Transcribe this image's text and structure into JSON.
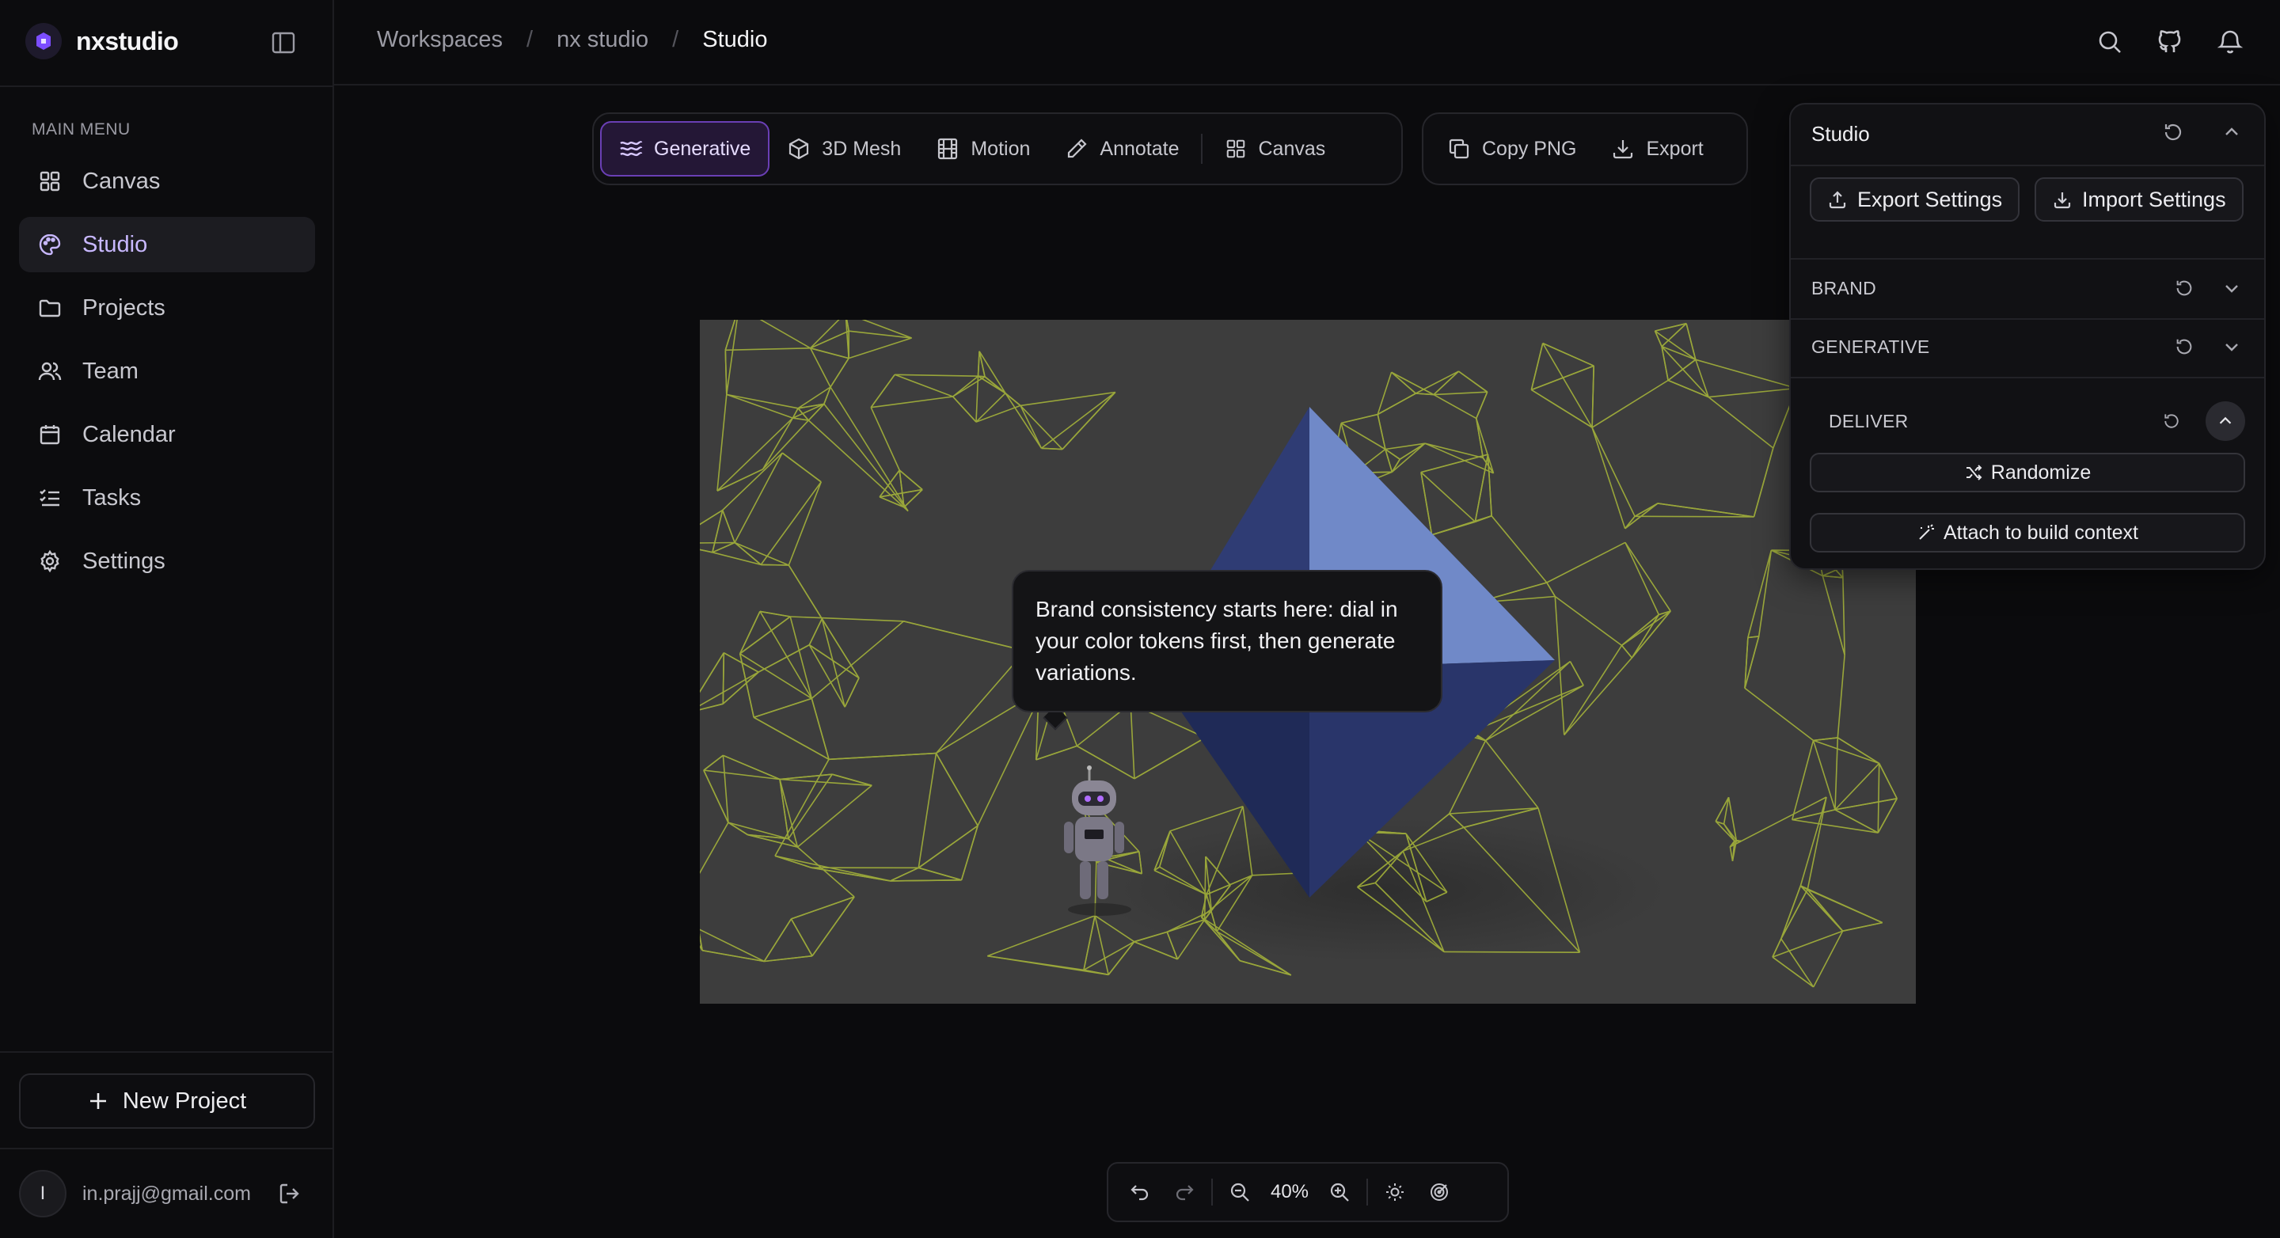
{
  "app": {
    "name": "nxstudio"
  },
  "sidebar": {
    "menu_heading": "MAIN MENU",
    "items": [
      {
        "label": "Canvas",
        "icon": "grid-icon",
        "active": false
      },
      {
        "label": "Studio",
        "icon": "palette-icon",
        "active": true
      },
      {
        "label": "Projects",
        "icon": "folder-icon",
        "active": false
      },
      {
        "label": "Team",
        "icon": "users-icon",
        "active": false
      },
      {
        "label": "Calendar",
        "icon": "calendar-icon",
        "active": false
      },
      {
        "label": "Tasks",
        "icon": "list-check-icon",
        "active": false
      },
      {
        "label": "Settings",
        "icon": "gear-icon",
        "active": false
      }
    ],
    "new_project_label": "New Project",
    "user": {
      "initial": "I",
      "email": "in.prajj@gmail.com"
    }
  },
  "breadcrumb": [
    "Workspaces",
    "nx studio",
    "Studio"
  ],
  "toolbar": {
    "modes": [
      {
        "label": "Generative",
        "icon": "waves-icon",
        "active": true
      },
      {
        "label": "3D Mesh",
        "icon": "cube-icon",
        "active": false
      },
      {
        "label": "Motion",
        "icon": "film-icon",
        "active": false
      },
      {
        "label": "Annotate",
        "icon": "pen-icon",
        "active": false
      },
      {
        "label": "Canvas",
        "icon": "grid-icon",
        "active": false
      }
    ],
    "actions": [
      {
        "label": "Copy PNG",
        "icon": "copy-icon"
      },
      {
        "label": "Export",
        "icon": "download-icon"
      }
    ]
  },
  "tooltip": {
    "text": "Brand consistency starts here: dial in your color tokens first, then generate variations."
  },
  "panel": {
    "title": "Studio",
    "export_settings_label": "Export Settings",
    "import_settings_label": "Import Settings",
    "sections": [
      {
        "label": "BRAND",
        "expanded": false
      },
      {
        "label": "GENERATIVE",
        "expanded": false
      }
    ],
    "deliver": {
      "label": "DELIVER",
      "randomize_label": "Randomize",
      "attach_label": "Attach to build context"
    }
  },
  "zoom": {
    "level": "40%"
  },
  "colors": {
    "accent": "#6a3fb5",
    "active_nav_text": "#c8b8ff",
    "canvas_bg": "#3d3d3d",
    "wireframe": "#b8c93a",
    "crystal_dark": "#2a3566",
    "crystal_light": "#6f86c4"
  }
}
